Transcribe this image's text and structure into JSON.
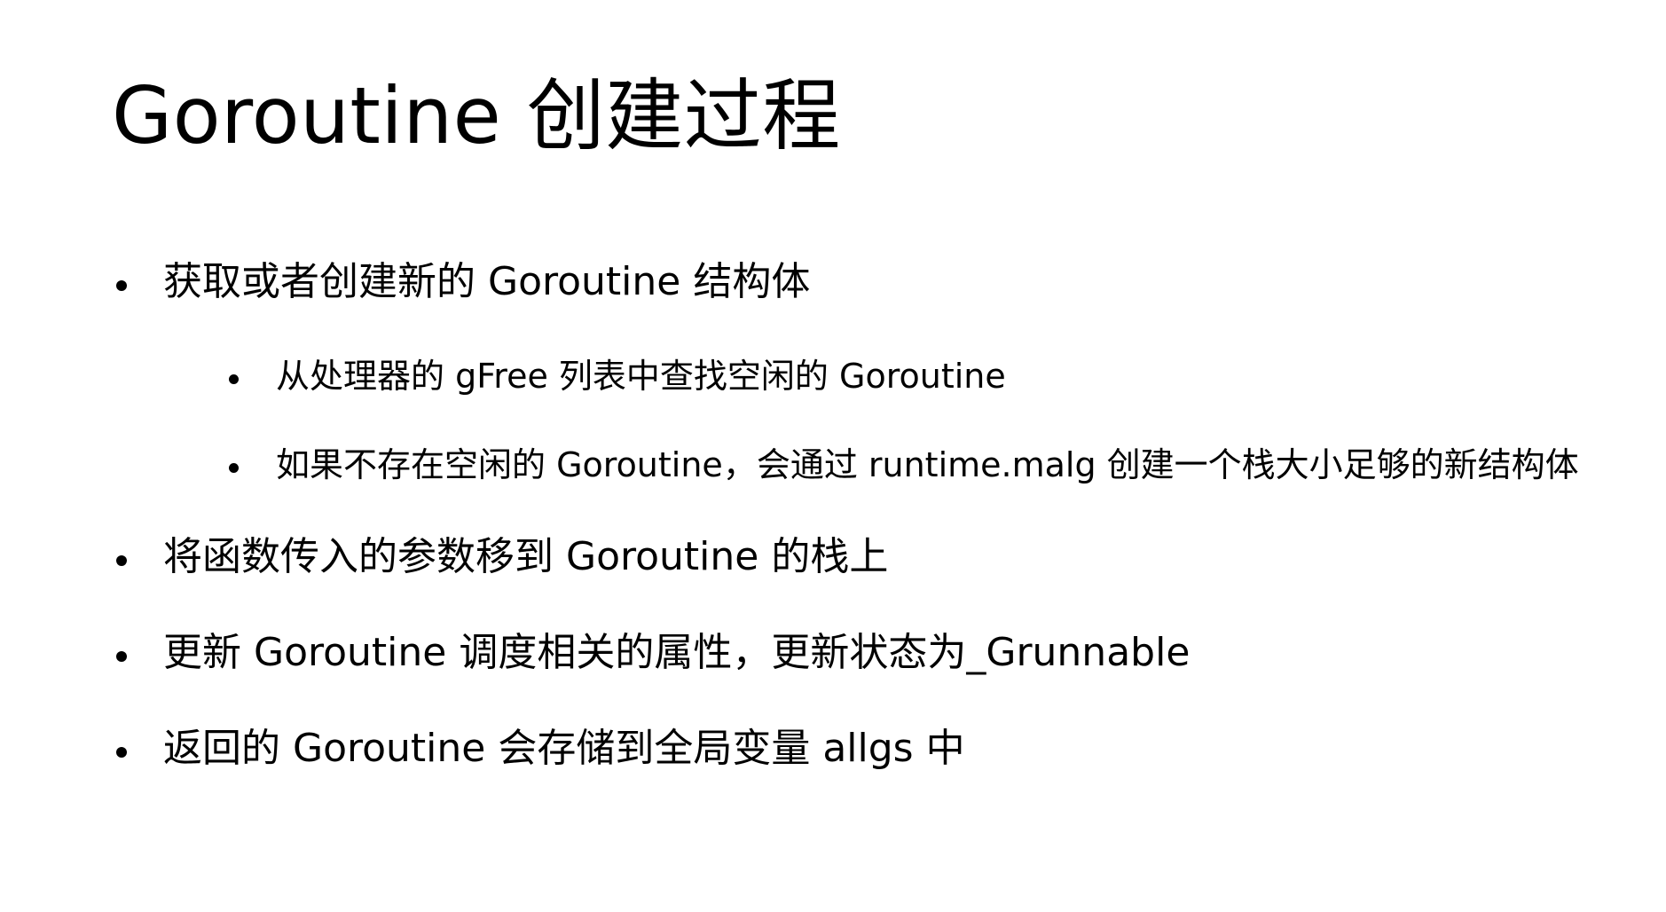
{
  "title": "Goroutine 创建过程",
  "bullets": [
    {
      "text": "获取或者创建新的 Goroutine 结构体"
    },
    {
      "text": "从处理器的 gFree 列表中查找空闲的 Goroutine"
    },
    {
      "text": "如果不存在空闲的 Goroutine，会通过 runtime.malg 创建一个栈大小足够的新结构体"
    },
    {
      "text": "将函数传入的参数移到 Goroutine 的栈上"
    },
    {
      "text": "更新 Goroutine 调度相关的属性，更新状态为_Grunnable"
    },
    {
      "text": "返回的 Goroutine 会存储到全局变量 allgs 中"
    }
  ]
}
